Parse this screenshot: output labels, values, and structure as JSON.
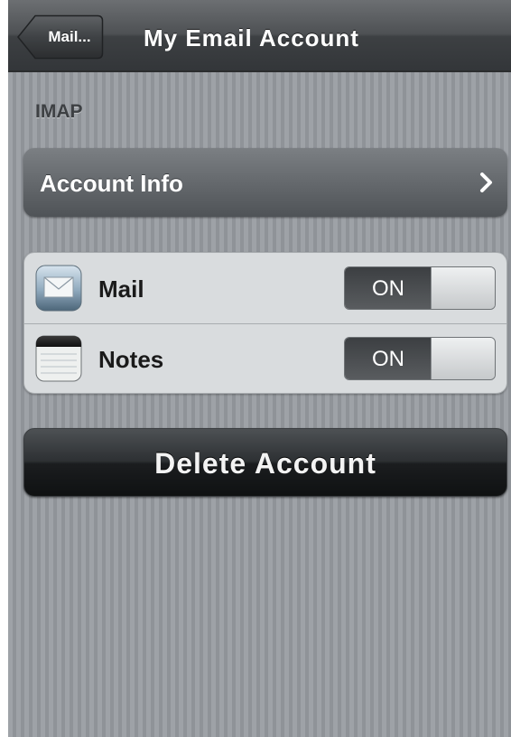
{
  "navbar": {
    "back_label": "Mail...",
    "title": "My Email Account"
  },
  "section": {
    "header": "IMAP"
  },
  "account_info": {
    "label": "Account Info",
    "icon": "chevron-right-icon"
  },
  "toggles": [
    {
      "label": "Mail",
      "icon": "mail-envelope-icon",
      "state": "ON"
    },
    {
      "label": "Notes",
      "icon": "notes-notepad-icon",
      "state": "ON"
    }
  ],
  "delete": {
    "label": "Delete Account"
  },
  "colors": {
    "background_stripe_light": "#9ea2a7",
    "background_stripe_dark": "#8f9398",
    "navbar": "#4e5154",
    "group_background": "#d9dcde",
    "delete_button": "#1b1d1f"
  }
}
